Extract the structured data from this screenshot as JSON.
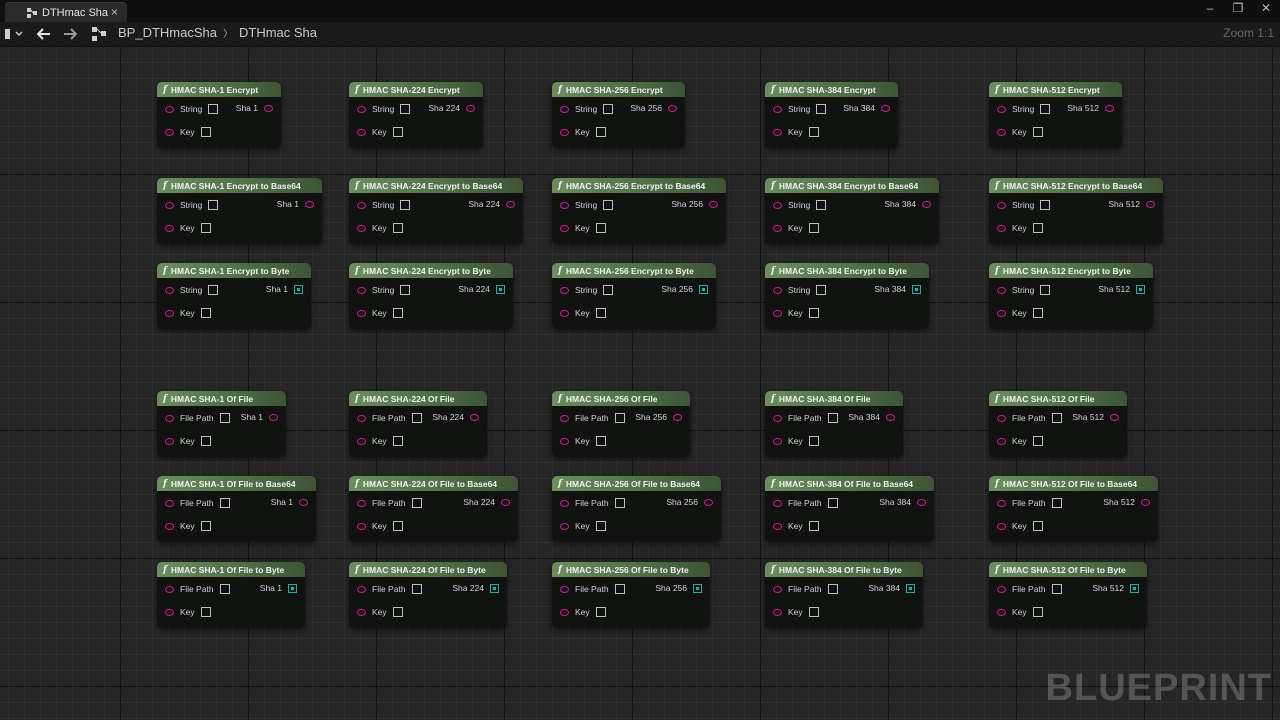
{
  "window": {
    "tab_title": "DTHmac Sha",
    "tab_close": "×",
    "min": "–",
    "max": "❐",
    "close": "✕"
  },
  "toolbar": {
    "breadcrumb_root": "BP_DTHmacSha",
    "breadcrumb_sep": "〉",
    "breadcrumb_current": "DTHmac Sha",
    "zoom_label": "Zoom 1:1"
  },
  "watermark": "BLUEPRINT",
  "fn_icon_glyph": "f",
  "pin_labels": {
    "string": "String",
    "file_path": "File Path",
    "key": "Key"
  },
  "columns": [
    {
      "alg": "SHA-1",
      "out": "Sha 1"
    },
    {
      "alg": "SHA-224",
      "out": "Sha 224"
    },
    {
      "alg": "SHA-256",
      "out": "Sha 256"
    },
    {
      "alg": "SHA-384",
      "out": "Sha 384"
    },
    {
      "alg": "SHA-512",
      "out": "Sha 512"
    }
  ],
  "rows": [
    {
      "suffix": "Encrypt",
      "input": "String",
      "output": "string"
    },
    {
      "suffix": "Encrypt to Base64",
      "input": "String",
      "output": "string"
    },
    {
      "suffix": "Encrypt to Byte",
      "input": "String",
      "output": "byte"
    },
    {
      "suffix": "Of File",
      "input": "File Path",
      "output": "string"
    },
    {
      "suffix": "Of File to Base64",
      "input": "File Path",
      "output": "string"
    },
    {
      "suffix": "Of File to Byte",
      "input": "File Path",
      "output": "byte"
    }
  ],
  "colors": {
    "string_pin": "#d3199a",
    "byte_pin": "#1fb0a0",
    "node_header": "#5a7b50"
  }
}
